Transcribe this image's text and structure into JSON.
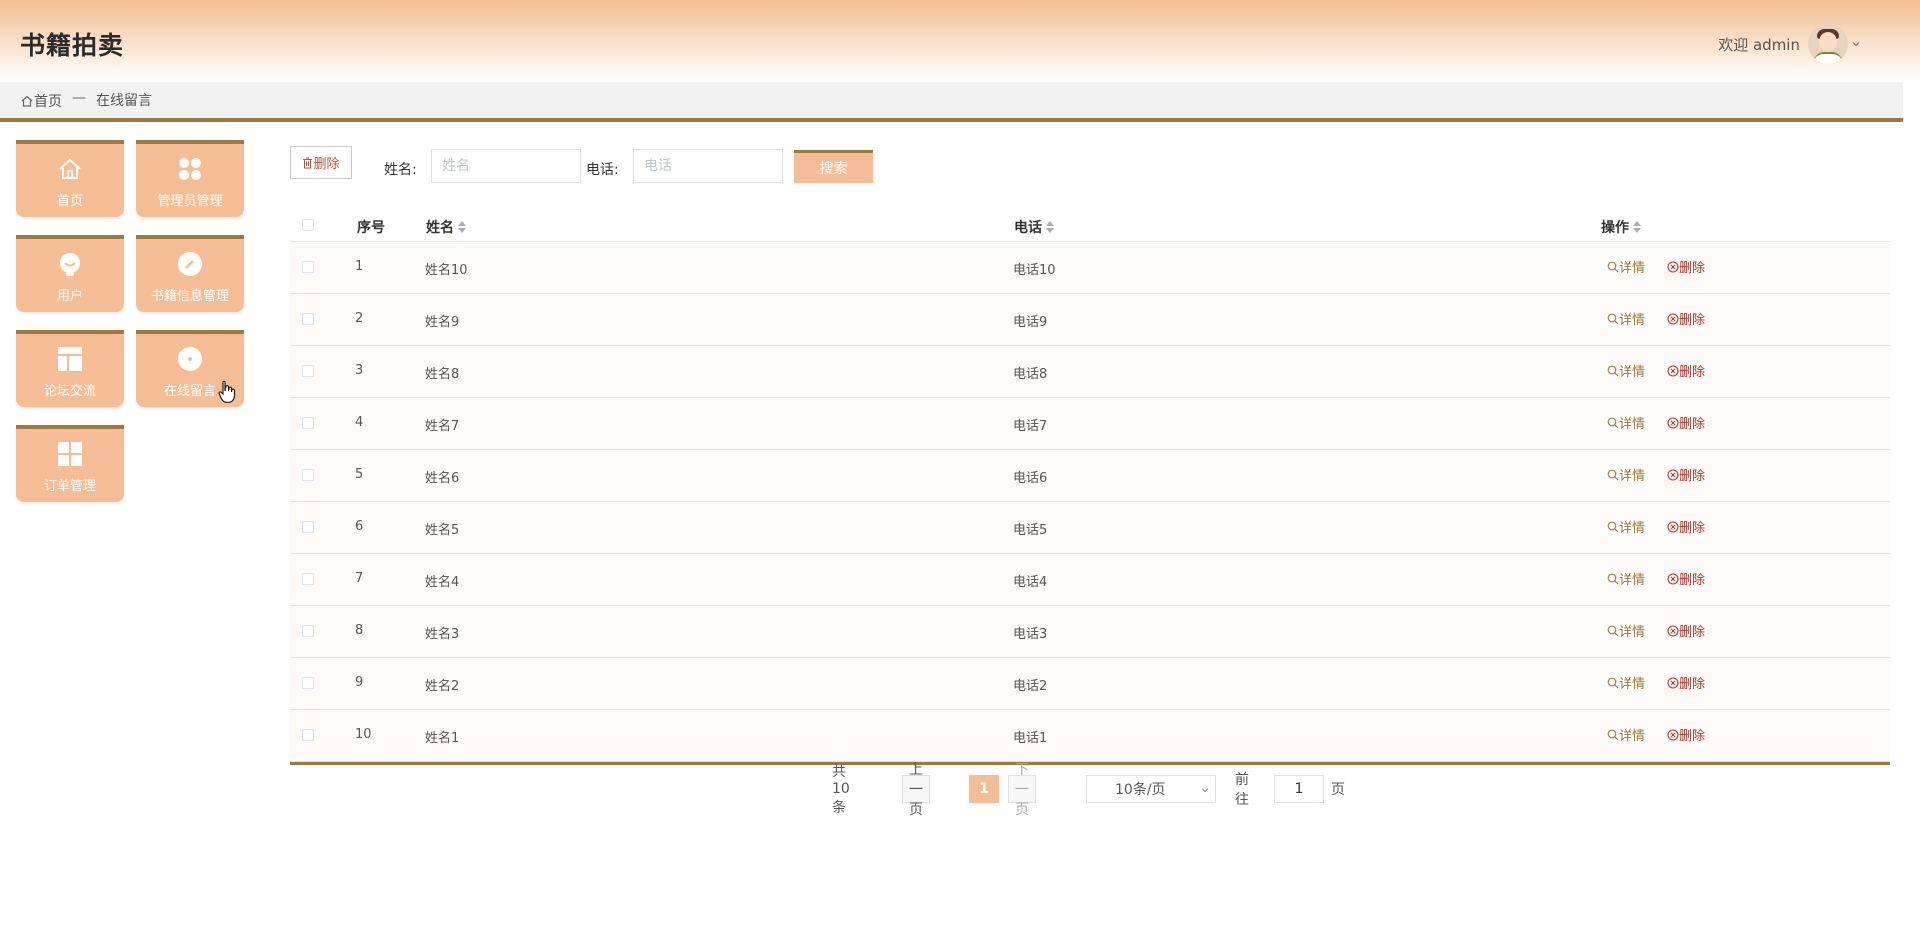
{
  "app": {
    "title": "书籍拍卖",
    "welcome": "欢迎 admin"
  },
  "breadcrumb": {
    "home": "首页",
    "separator": "—",
    "current": "在线留言"
  },
  "sidebar": {
    "items": [
      {
        "label": "首页",
        "icon": "home-icon"
      },
      {
        "label": "管理员管理",
        "icon": "grid-dots-icon"
      },
      {
        "label": "用户",
        "icon": "user-icon"
      },
      {
        "label": "书籍信息管理",
        "icon": "edit-icon"
      },
      {
        "label": "论坛交流",
        "icon": "layout-icon"
      },
      {
        "label": "在线留言",
        "icon": "message-icon"
      },
      {
        "label": "订单管理",
        "icon": "grid-icon"
      }
    ]
  },
  "toolbar": {
    "delete_label": "删除",
    "name_label": "姓名:",
    "name_placeholder": "姓名",
    "phone_label": "电话:",
    "phone_placeholder": "电话",
    "search_label": "搜索"
  },
  "table": {
    "columns": {
      "index": "序号",
      "name": "姓名",
      "phone": "电话",
      "actions": "操作"
    },
    "view_label": "详情",
    "delete_label": "删除",
    "rows": [
      {
        "index": "1",
        "name": "姓名10",
        "phone": "电话10"
      },
      {
        "index": "2",
        "name": "姓名9",
        "phone": "电话9"
      },
      {
        "index": "3",
        "name": "姓名8",
        "phone": "电话8"
      },
      {
        "index": "4",
        "name": "姓名7",
        "phone": "电话7"
      },
      {
        "index": "5",
        "name": "姓名6",
        "phone": "电话6"
      },
      {
        "index": "6",
        "name": "姓名5",
        "phone": "电话5"
      },
      {
        "index": "7",
        "name": "姓名4",
        "phone": "电话4"
      },
      {
        "index": "8",
        "name": "姓名3",
        "phone": "电话3"
      },
      {
        "index": "9",
        "name": "姓名2",
        "phone": "电话2"
      },
      {
        "index": "10",
        "name": "姓名1",
        "phone": "电话1"
      }
    ]
  },
  "pagination": {
    "total": "共 10 条",
    "prev": "上一页",
    "current_page": "1",
    "next": "下一页",
    "page_size": "10条/页",
    "goto_label": "前往",
    "goto_value": "1",
    "page_unit": "页"
  },
  "colors": {
    "accent": "#f4bd95",
    "border_brown": "#9a7a3f"
  }
}
